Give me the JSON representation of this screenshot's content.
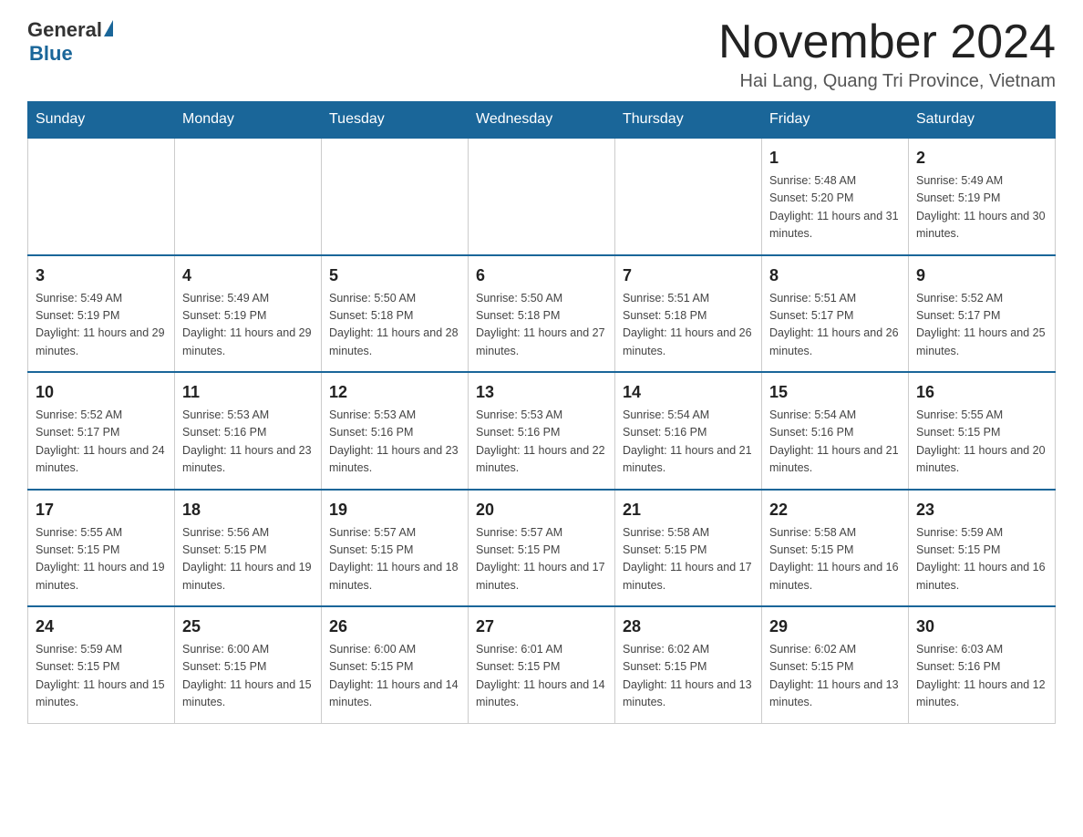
{
  "header": {
    "logo_general": "General",
    "logo_blue": "Blue",
    "month_title": "November 2024",
    "subtitle": "Hai Lang, Quang Tri Province, Vietnam"
  },
  "weekdays": [
    "Sunday",
    "Monday",
    "Tuesday",
    "Wednesday",
    "Thursday",
    "Friday",
    "Saturday"
  ],
  "rows": [
    [
      {
        "day": "",
        "info": ""
      },
      {
        "day": "",
        "info": ""
      },
      {
        "day": "",
        "info": ""
      },
      {
        "day": "",
        "info": ""
      },
      {
        "day": "",
        "info": ""
      },
      {
        "day": "1",
        "info": "Sunrise: 5:48 AM\nSunset: 5:20 PM\nDaylight: 11 hours and 31 minutes."
      },
      {
        "day": "2",
        "info": "Sunrise: 5:49 AM\nSunset: 5:19 PM\nDaylight: 11 hours and 30 minutes."
      }
    ],
    [
      {
        "day": "3",
        "info": "Sunrise: 5:49 AM\nSunset: 5:19 PM\nDaylight: 11 hours and 29 minutes."
      },
      {
        "day": "4",
        "info": "Sunrise: 5:49 AM\nSunset: 5:19 PM\nDaylight: 11 hours and 29 minutes."
      },
      {
        "day": "5",
        "info": "Sunrise: 5:50 AM\nSunset: 5:18 PM\nDaylight: 11 hours and 28 minutes."
      },
      {
        "day": "6",
        "info": "Sunrise: 5:50 AM\nSunset: 5:18 PM\nDaylight: 11 hours and 27 minutes."
      },
      {
        "day": "7",
        "info": "Sunrise: 5:51 AM\nSunset: 5:18 PM\nDaylight: 11 hours and 26 minutes."
      },
      {
        "day": "8",
        "info": "Sunrise: 5:51 AM\nSunset: 5:17 PM\nDaylight: 11 hours and 26 minutes."
      },
      {
        "day": "9",
        "info": "Sunrise: 5:52 AM\nSunset: 5:17 PM\nDaylight: 11 hours and 25 minutes."
      }
    ],
    [
      {
        "day": "10",
        "info": "Sunrise: 5:52 AM\nSunset: 5:17 PM\nDaylight: 11 hours and 24 minutes."
      },
      {
        "day": "11",
        "info": "Sunrise: 5:53 AM\nSunset: 5:16 PM\nDaylight: 11 hours and 23 minutes."
      },
      {
        "day": "12",
        "info": "Sunrise: 5:53 AM\nSunset: 5:16 PM\nDaylight: 11 hours and 23 minutes."
      },
      {
        "day": "13",
        "info": "Sunrise: 5:53 AM\nSunset: 5:16 PM\nDaylight: 11 hours and 22 minutes."
      },
      {
        "day": "14",
        "info": "Sunrise: 5:54 AM\nSunset: 5:16 PM\nDaylight: 11 hours and 21 minutes."
      },
      {
        "day": "15",
        "info": "Sunrise: 5:54 AM\nSunset: 5:16 PM\nDaylight: 11 hours and 21 minutes."
      },
      {
        "day": "16",
        "info": "Sunrise: 5:55 AM\nSunset: 5:15 PM\nDaylight: 11 hours and 20 minutes."
      }
    ],
    [
      {
        "day": "17",
        "info": "Sunrise: 5:55 AM\nSunset: 5:15 PM\nDaylight: 11 hours and 19 minutes."
      },
      {
        "day": "18",
        "info": "Sunrise: 5:56 AM\nSunset: 5:15 PM\nDaylight: 11 hours and 19 minutes."
      },
      {
        "day": "19",
        "info": "Sunrise: 5:57 AM\nSunset: 5:15 PM\nDaylight: 11 hours and 18 minutes."
      },
      {
        "day": "20",
        "info": "Sunrise: 5:57 AM\nSunset: 5:15 PM\nDaylight: 11 hours and 17 minutes."
      },
      {
        "day": "21",
        "info": "Sunrise: 5:58 AM\nSunset: 5:15 PM\nDaylight: 11 hours and 17 minutes."
      },
      {
        "day": "22",
        "info": "Sunrise: 5:58 AM\nSunset: 5:15 PM\nDaylight: 11 hours and 16 minutes."
      },
      {
        "day": "23",
        "info": "Sunrise: 5:59 AM\nSunset: 5:15 PM\nDaylight: 11 hours and 16 minutes."
      }
    ],
    [
      {
        "day": "24",
        "info": "Sunrise: 5:59 AM\nSunset: 5:15 PM\nDaylight: 11 hours and 15 minutes."
      },
      {
        "day": "25",
        "info": "Sunrise: 6:00 AM\nSunset: 5:15 PM\nDaylight: 11 hours and 15 minutes."
      },
      {
        "day": "26",
        "info": "Sunrise: 6:00 AM\nSunset: 5:15 PM\nDaylight: 11 hours and 14 minutes."
      },
      {
        "day": "27",
        "info": "Sunrise: 6:01 AM\nSunset: 5:15 PM\nDaylight: 11 hours and 14 minutes."
      },
      {
        "day": "28",
        "info": "Sunrise: 6:02 AM\nSunset: 5:15 PM\nDaylight: 11 hours and 13 minutes."
      },
      {
        "day": "29",
        "info": "Sunrise: 6:02 AM\nSunset: 5:15 PM\nDaylight: 11 hours and 13 minutes."
      },
      {
        "day": "30",
        "info": "Sunrise: 6:03 AM\nSunset: 5:16 PM\nDaylight: 11 hours and 12 minutes."
      }
    ]
  ]
}
